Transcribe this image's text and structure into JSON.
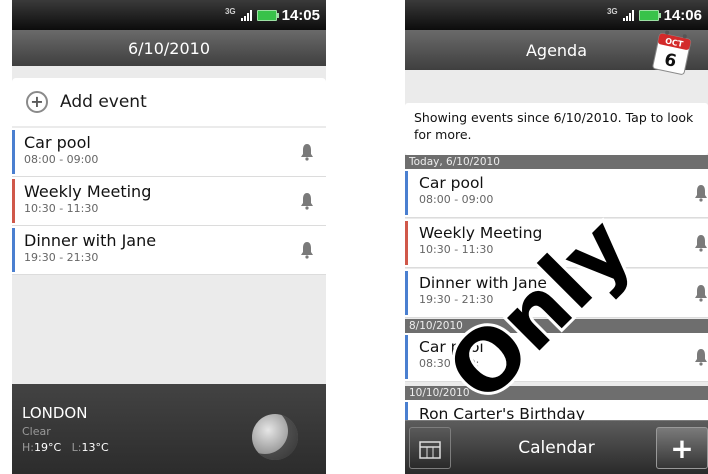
{
  "left": {
    "status": {
      "network": "3G",
      "time": "14:05"
    },
    "header": {
      "date": "6/10/2010"
    },
    "add_event_label": "Add event",
    "events": [
      {
        "title": "Car pool",
        "time": "08:00 - 09:00",
        "color": "#4a7fd0"
      },
      {
        "title": "Weekly Meeting",
        "time": "10:30 - 11:30",
        "color": "#d0584a"
      },
      {
        "title": "Dinner with Jane",
        "time": "19:30 - 21:30",
        "color": "#4a7fd0"
      }
    ],
    "weather": {
      "city": "LONDON",
      "condition": "Clear",
      "high_label": "H:",
      "high": "19°C",
      "low_label": "L:",
      "low": "13°C",
      "icon": "moon-icon"
    }
  },
  "right": {
    "status": {
      "network": "3G",
      "time": "14:06"
    },
    "header": {
      "title": "Agenda",
      "calendar_icon_month": "OCT",
      "calendar_icon_day": "6"
    },
    "notice": "Showing events since 6/10/2010. Tap to look for more.",
    "groups": [
      {
        "date": "Today, 6/10/2010",
        "events": [
          {
            "title": "Car pool",
            "time": "08:00 - 09:00",
            "color": "#4a7fd0"
          },
          {
            "title": "Weekly Meeting",
            "time": "10:30 - 11:30",
            "color": "#d0584a"
          },
          {
            "title": "Dinner with Jane",
            "time": "19:30 - 21:30",
            "color": "#4a7fd0"
          }
        ]
      },
      {
        "date": "8/10/2010",
        "events": [
          {
            "title": "Car pool",
            "time": "08:30 - 09:",
            "color": "#4a7fd0"
          }
        ]
      },
      {
        "date": "10/10/2010",
        "events": [
          {
            "title": "Ron Carter's Birthday",
            "time": "",
            "color": "#4a7fd0"
          }
        ]
      }
    ],
    "bottom_bar": {
      "title": "Calendar",
      "add_label": "+"
    }
  },
  "watermark": {
    "text": "Only",
    "color": "#000000"
  }
}
